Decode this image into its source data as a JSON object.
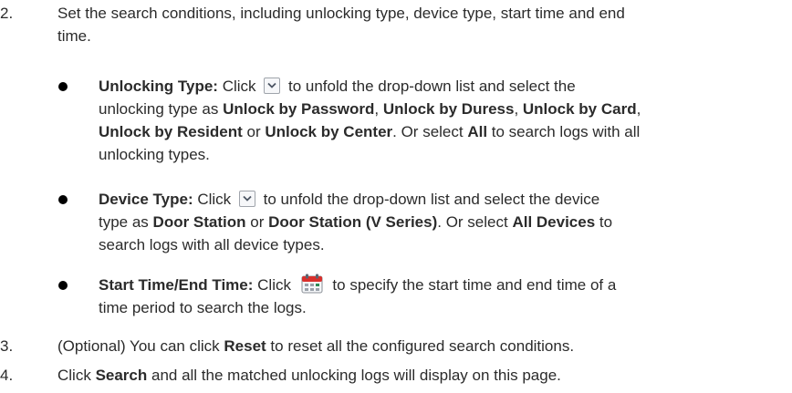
{
  "steps": [
    {
      "number": "2.",
      "line1": "Set the search conditions, including unlocking type, device type, start time and end",
      "line2": "time."
    },
    {
      "number": "3.",
      "pre": "(Optional) You can click ",
      "bold": "Reset",
      "post": " to reset all the configured search conditions."
    },
    {
      "number": "4.",
      "pre": "Click ",
      "bold": "Search",
      "post": " and all the matched unlocking logs will display on this page."
    }
  ],
  "bullets": {
    "unlocking": {
      "label": "Unlocking Type:",
      "click": " Click ",
      "after_icon": " to unfold the drop-down list and select the",
      "line2_pre": "unlocking type as ",
      "opt1": "Unlock by Password",
      "sep1": ", ",
      "opt2": "Unlock by Duress",
      "sep2": ", ",
      "opt3": "Unlock by Card",
      "sep3": ",",
      "opt4": "Unlock by Resident",
      "or1": " or ",
      "opt5": "Unlock by Center",
      "line3_mid": ". Or select ",
      "opt_all": "All",
      "line3_post": " to search logs with all",
      "line4": "unlocking types."
    },
    "device": {
      "label": "Device Type:",
      "click": " Click ",
      "after_icon": " to unfold the drop-down list and select the device",
      "line2_pre": "type as ",
      "opt1": "Door Station",
      "or1": " or ",
      "opt2": "Door Station (V Series)",
      "line2_mid": ". Or select ",
      "opt_all": "All Devices",
      "line2_post": " to",
      "line3": "search logs with all device types."
    },
    "time": {
      "label": "Start Time/End Time:",
      "click": " Click ",
      "after_icon": " to specify the start time and end time of a",
      "line2": "time period to search the logs."
    }
  },
  "icons": {
    "dropdown": "chevron-down-icon",
    "calendar": "calendar-icon",
    "bullet": "bullet-dot"
  },
  "colors": {
    "text": "#2b2b2b",
    "calendar_red": "#d9302c"
  }
}
